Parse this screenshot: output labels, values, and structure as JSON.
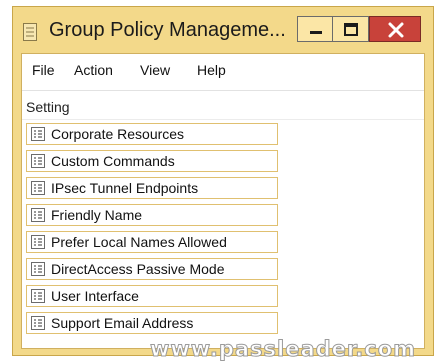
{
  "window": {
    "title": "Group Policy Manageme...",
    "icon": "app-icon",
    "controls": [
      "minimize-icon",
      "maximize-icon",
      "close-icon"
    ]
  },
  "menu": [
    "File",
    "Action",
    "View",
    "Help"
  ],
  "list": {
    "column_header": "Setting",
    "row_icon": "setting-icon",
    "items": [
      {
        "label": "Corporate Resources"
      },
      {
        "label": "Custom Commands"
      },
      {
        "label": "IPsec Tunnel Endpoints"
      },
      {
        "label": "Friendly Name"
      },
      {
        "label": "Prefer Local Names Allowed"
      },
      {
        "label": "DirectAccess Passive Mode"
      },
      {
        "label": "User Interface"
      },
      {
        "label": "Support Email Address"
      }
    ]
  },
  "watermark": "www.passleader.com",
  "colors": {
    "frame": "#f3d98a",
    "close": "#c8423a",
    "row_border": "#e0c070"
  }
}
